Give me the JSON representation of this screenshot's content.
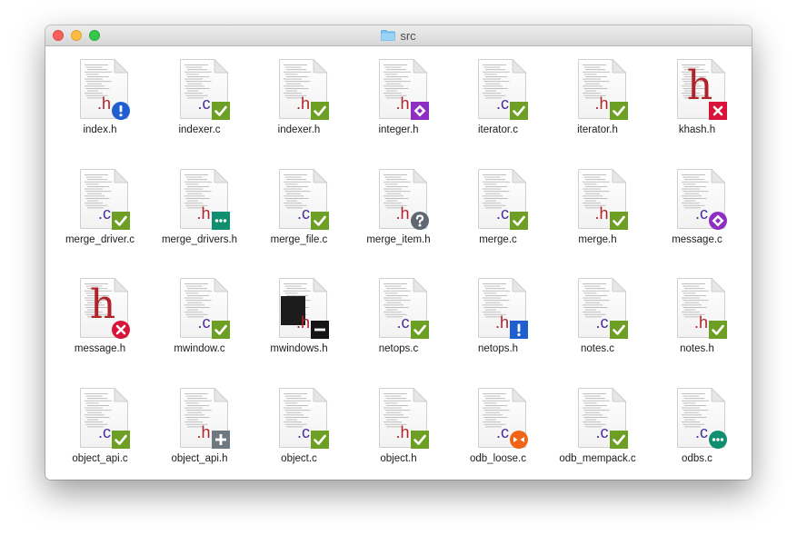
{
  "window": {
    "title": "src",
    "title_icon": "folder-icon",
    "controls": [
      "close-button",
      "minimize-button",
      "zoom-button"
    ]
  },
  "status_colors": {
    "ok": "#6c9f23",
    "info": "#1f5fcf",
    "conflict": "#d9143a",
    "modified": "#8d2fc2",
    "unknown": "#5f6872",
    "pending": "#0f8f6f",
    "deleted": "#151515",
    "added": "#6f7780",
    "incoming": "#f06418"
  },
  "files": [
    {
      "name": "index.h",
      "ext": ".h",
      "badge": "info-icon"
    },
    {
      "name": "indexer.c",
      "ext": ".c",
      "badge": "checkmark-icon"
    },
    {
      "name": "indexer.h",
      "ext": ".h",
      "badge": "checkmark-icon"
    },
    {
      "name": "integer.h",
      "ext": ".h",
      "badge": "modified-icon"
    },
    {
      "name": "iterator.c",
      "ext": ".c",
      "badge": "checkmark-icon"
    },
    {
      "name": "iterator.h",
      "ext": ".h",
      "badge": "checkmark-icon"
    },
    {
      "name": "khash.h",
      "ext": "h",
      "badge": "conflict-icon",
      "large_letter": true
    },
    {
      "name": "merge_driver.c",
      "ext": ".c",
      "badge": "checkmark-icon"
    },
    {
      "name": "merge_drivers.h",
      "ext": ".h",
      "badge": "ellipsis-icon"
    },
    {
      "name": "merge_file.c",
      "ext": ".c",
      "badge": "checkmark-icon"
    },
    {
      "name": "merge_item.h",
      "ext": ".h",
      "badge": "question-icon"
    },
    {
      "name": "merge.c",
      "ext": ".c",
      "badge": "checkmark-icon"
    },
    {
      "name": "merge.h",
      "ext": ".h",
      "badge": "checkmark-icon"
    },
    {
      "name": "message.c",
      "ext": ".c",
      "badge": "modified-circle-icon"
    },
    {
      "name": "message.h",
      "ext": "h",
      "badge": "conflict-circle-icon",
      "large_letter": true
    },
    {
      "name": "mwindow.c",
      "ext": ".c",
      "badge": "checkmark-icon"
    },
    {
      "name": "mwindows.h",
      "ext": ".h",
      "badge": "minus-icon",
      "dark_page": true
    },
    {
      "name": "netops.c",
      "ext": ".c",
      "badge": "checkmark-icon"
    },
    {
      "name": "netops.h",
      "ext": ".h",
      "badge": "exclamation-icon"
    },
    {
      "name": "notes.c",
      "ext": ".c",
      "badge": "checkmark-icon"
    },
    {
      "name": "notes.h",
      "ext": ".h",
      "badge": "checkmark-icon"
    },
    {
      "name": "object_api.c",
      "ext": ".c",
      "badge": "checkmark-icon"
    },
    {
      "name": "object_api.h",
      "ext": ".h",
      "badge": "plus-icon"
    },
    {
      "name": "object.c",
      "ext": ".c",
      "badge": "checkmark-icon"
    },
    {
      "name": "object.h",
      "ext": ".h",
      "badge": "checkmark-icon"
    },
    {
      "name": "odb_loose.c",
      "ext": ".c",
      "badge": "incoming-icon"
    },
    {
      "name": "odb_mempack.c",
      "ext": ".c",
      "badge": "checkmark-icon"
    },
    {
      "name": "odbs.c",
      "ext": ".c",
      "badge": "ellipsis-circle-icon"
    }
  ]
}
